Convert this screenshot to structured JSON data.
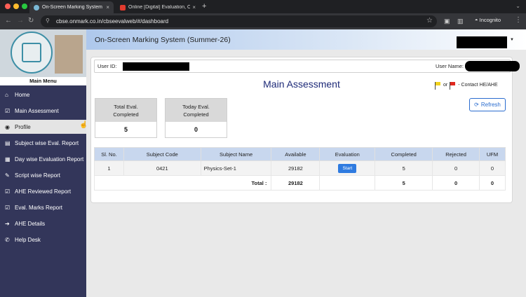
{
  "browser": {
    "tabs": [
      {
        "title": "On-Screen Marking System",
        "active": true,
        "favicon_color": "#7ab8d6"
      },
      {
        "title": "Online [Digital] Evaluation, O...",
        "active": false,
        "favicon_color": "#e23b2e"
      }
    ],
    "url": "cbse.onmark.co.in/cbseevalweb/#/dashboard",
    "incognito_label": "Incognito"
  },
  "sidebar": {
    "menu_heading": "Main Menu",
    "items": [
      {
        "label": "Home",
        "icon": "home-icon",
        "glyph": "⌂"
      },
      {
        "label": "Main Assessment",
        "icon": "checkbox-icon",
        "glyph": "☑"
      },
      {
        "label": "Profile",
        "icon": "user-circle-icon",
        "glyph": "◉"
      },
      {
        "label": "Subject wise Eval. Report",
        "icon": "document-icon",
        "glyph": "▤"
      },
      {
        "label": "Day wise Evaluation Report",
        "icon": "calendar-icon",
        "glyph": "▦"
      },
      {
        "label": "Script wise Report",
        "icon": "edit-icon",
        "glyph": "✎"
      },
      {
        "label": "AHE Reviewed Report",
        "icon": "checkbox-icon",
        "glyph": "☑"
      },
      {
        "label": "Eval. Marks Report",
        "icon": "checkbox-icon",
        "glyph": "☑"
      },
      {
        "label": "AHE Details",
        "icon": "arrow-circle-icon",
        "glyph": "➔"
      },
      {
        "label": "Help Desk",
        "icon": "phone-icon",
        "glyph": "✆"
      }
    ]
  },
  "header": {
    "title": "On-Screen Marking System (Summer-26)"
  },
  "main": {
    "user_id_label": "User ID:",
    "user_name_label": "User Name:",
    "title": "Main Assessment",
    "flags_or": "or",
    "flags_text": "- Contact HE/AHE",
    "flag_colors": {
      "first": "#f1d21e",
      "second": "#e0281f"
    },
    "stats": [
      {
        "label_line1": "Total Eval.",
        "label_line2": "Completed",
        "value": "5"
      },
      {
        "label_line1": "Today Eval.",
        "label_line2": "Completed",
        "value": "0"
      }
    ],
    "refresh_label": "Refresh",
    "table": {
      "headers": [
        "Sl. No.",
        "Subject Code",
        "Subject Name",
        "Available",
        "Evaluation",
        "Completed",
        "Rejected",
        "UFM"
      ],
      "row": {
        "sl": "1",
        "code": "0421",
        "name": "Physics-Set-1",
        "available": "29182",
        "action": "Start",
        "completed": "5",
        "rejected": "0",
        "ufm": "0"
      },
      "total": {
        "label": "Total :",
        "available": "29182",
        "completed": "5",
        "rejected": "0",
        "ufm": "0"
      }
    }
  }
}
